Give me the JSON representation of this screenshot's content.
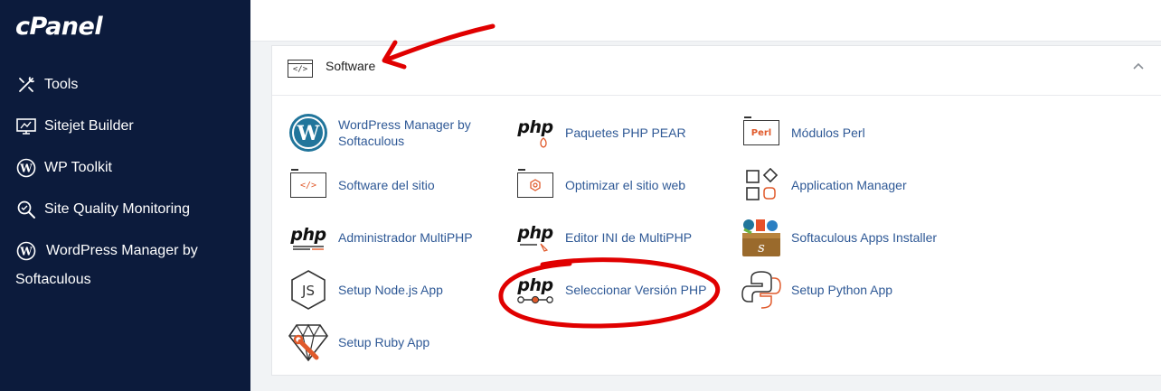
{
  "sidebar": {
    "logo": "cPanel",
    "items": [
      {
        "label": "Tools",
        "icon": "tools-icon"
      },
      {
        "label": "Sitejet Builder",
        "icon": "monitor-icon"
      },
      {
        "label": "WP Toolkit",
        "icon": "wordpress-icon"
      },
      {
        "label": "Site Quality Monitoring",
        "icon": "magnifier-icon"
      },
      {
        "label": "WordPress Manager by Softaculous",
        "icon": "wordpress-icon"
      }
    ]
  },
  "section": {
    "title": "Software",
    "icon": "code-window-icon",
    "collapse_icon": "chevron-up-icon"
  },
  "apps": [
    {
      "label": "WordPress Manager by Softaculous",
      "icon": "wordpress-icon"
    },
    {
      "label": "Paquetes PHP PEAR",
      "icon": "php-pear-icon"
    },
    {
      "label": "Módulos Perl",
      "icon": "perl-icon"
    },
    {
      "label": "Software del sitio",
      "icon": "code-window-icon"
    },
    {
      "label": "Optimizar el sitio web",
      "icon": "optimize-icon"
    },
    {
      "label": "Application Manager",
      "icon": "app-manager-icon"
    },
    {
      "label": "Administrador MultiPHP",
      "icon": "multiphp-icon"
    },
    {
      "label": "Editor INI de MultiPHP",
      "icon": "multiphp-ini-icon"
    },
    {
      "label": "Softaculous Apps Installer",
      "icon": "softaculous-icon"
    },
    {
      "label": "Setup Node.js App",
      "icon": "nodejs-icon"
    },
    {
      "label": "Seleccionar Versión PHP",
      "icon": "php-selector-icon"
    },
    {
      "label": "Setup Python App",
      "icon": "python-icon"
    },
    {
      "label": "Setup Ruby App",
      "icon": "ruby-icon"
    }
  ],
  "icon_text": {
    "php": "php",
    "perl": "Perl",
    "code": "</>"
  },
  "colors": {
    "sidebar_bg": "#0c1b3c",
    "link": "#2f5996",
    "annotation": "#e00000",
    "accent_orange": "#e05a2b"
  }
}
